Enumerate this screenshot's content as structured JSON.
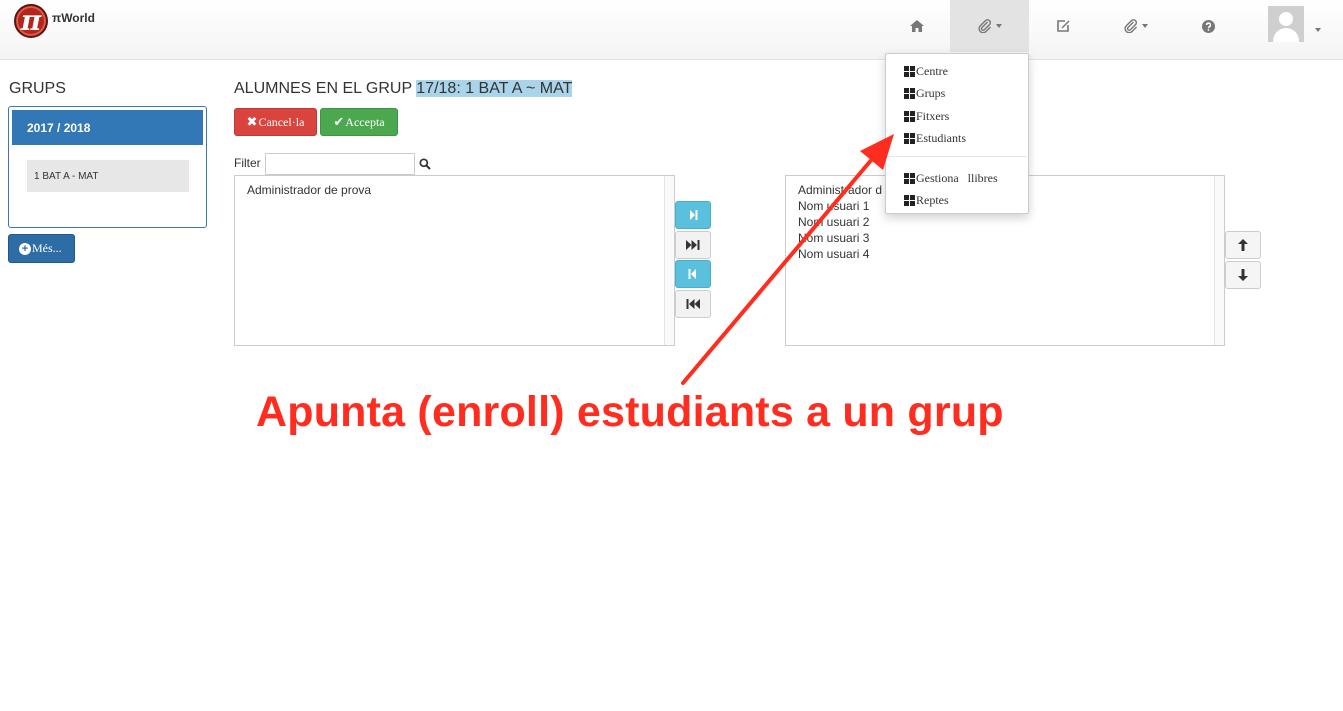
{
  "navbar": {
    "brand": "πWorld",
    "logo_symbol": "π",
    "items": [
      {
        "name": "home",
        "icon": "home-icon"
      },
      {
        "name": "attachments-menu",
        "icon": "paperclip-icon",
        "active": true,
        "dropdown": true
      },
      {
        "name": "edit",
        "icon": "edit-icon"
      },
      {
        "name": "attachments-menu-2",
        "icon": "paperclip-icon",
        "dropdown": true
      },
      {
        "name": "help",
        "icon": "question-icon"
      }
    ],
    "user_menu": {
      "icon": "user-avatar-icon",
      "dropdown": true
    }
  },
  "dropdown": {
    "items": [
      "Centre",
      "Grups",
      "Fitxers",
      "Estudiants"
    ],
    "items_after_divider": [
      "Gestiona   llibres",
      "Reptes"
    ]
  },
  "sidebar": {
    "title": "GRUPS",
    "year": "2017 / 2018",
    "groups": [
      "1 BAT A - MAT"
    ],
    "more_button": "Més..."
  },
  "main": {
    "title_prefix": "ALUMNES EN EL GRUP ",
    "title_group": "17/18: 1 BAT A ~ MAT",
    "cancel_label": "Cancel·la",
    "accept_label": "Accepta",
    "filter_label": "Filter",
    "filter_value": "",
    "left_list": [
      "Administrador de prova"
    ],
    "right_list": [
      "Administrador d",
      "Nom usuari 1",
      "Nom usuari 2",
      "Nom usuari 3",
      "Nom usuari 4"
    ]
  },
  "annotation": {
    "text": "Apunta (enroll) estudiants a un grup",
    "color": "#ff2d1f"
  },
  "colors": {
    "primary": "#3277b6",
    "danger": "#d9443f",
    "success": "#4ba84e",
    "info": "#5bc0de",
    "highlight": "#a9d4ea"
  }
}
